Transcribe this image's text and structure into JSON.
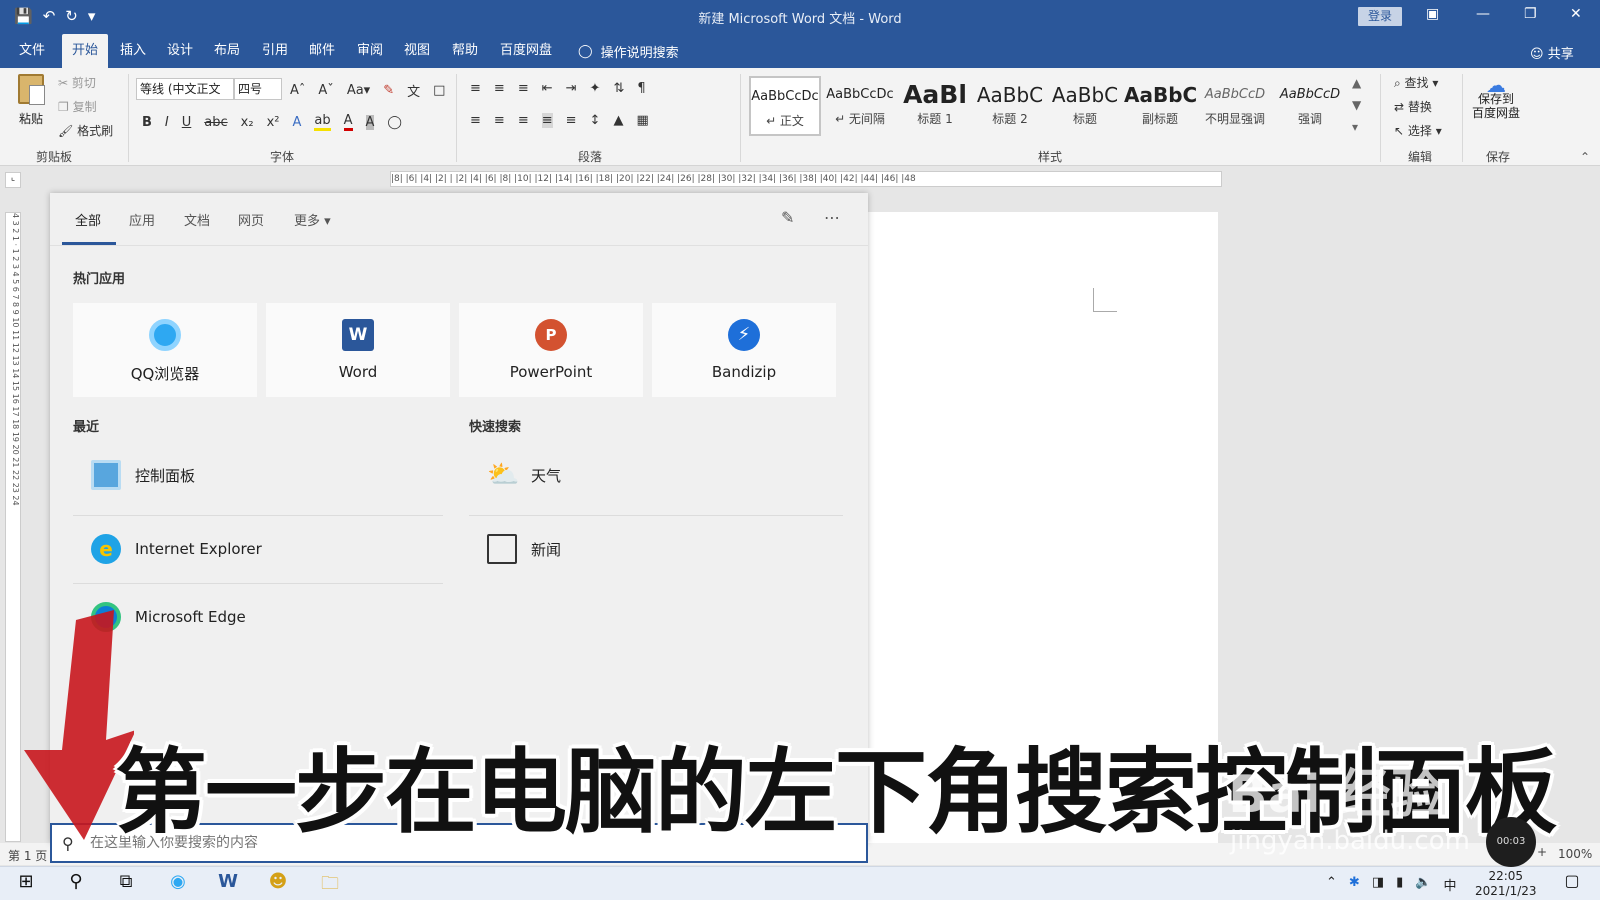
{
  "window": {
    "title": "新建 Microsoft Word 文档 - Word",
    "login_label": "登录",
    "share_label": "共享"
  },
  "qat": [
    "save-icon",
    "undo-icon",
    "redo-icon",
    "customize-icon"
  ],
  "tabs": [
    "文件",
    "开始",
    "插入",
    "设计",
    "布局",
    "引用",
    "邮件",
    "审阅",
    "视图",
    "帮助",
    "百度网盘"
  ],
  "active_tab": "开始",
  "tell_me": "操作说明搜索",
  "ribbon": {
    "clipboard": {
      "paste": "粘贴",
      "cut": "剪切",
      "copy": "复制",
      "format_painter": "格式刷",
      "label": "剪贴板"
    },
    "font": {
      "font_name": "等线 (中文正文",
      "font_size": "四号",
      "label": "字体"
    },
    "paragraph": {
      "label": "段落"
    },
    "styles": {
      "label": "样式",
      "items": [
        {
          "sample": "AaBbCcDc",
          "name": "↵ 正文"
        },
        {
          "sample": "AaBbCcDc",
          "name": "↵ 无间隔"
        },
        {
          "sample": "AaBl",
          "name": "标题 1"
        },
        {
          "sample": "AaBbC",
          "name": "标题 2"
        },
        {
          "sample": "AaBbC",
          "name": "标题"
        },
        {
          "sample": "AaBbC",
          "name": "副标题"
        },
        {
          "sample": "AaBbCcD",
          "name": "不明显强调"
        },
        {
          "sample": "AaBbCcD",
          "name": "强调"
        }
      ]
    },
    "editing": {
      "find": "查找",
      "replace": "替换",
      "select": "选择",
      "label": "编辑"
    },
    "save": {
      "button": "保存到\n百度网盘",
      "label": "保存"
    }
  },
  "ruler_marks": "|8| |6| |4| |2| | |2| |4| |6| |8| |10| |12| |14| |16| |18| |20| |22| |24| |26| |28| |30| |32| |34| |36| |38| |40| |42| |44| |46| |48",
  "vruler_marks": "4 3 2 1 · 1 2 3 4 5 6 7 8 9 10 11 12 13 14 15 16 17 18 19 20 21 22 23 24",
  "status": {
    "page": "第 1 页",
    "zoom": "100%"
  },
  "search_panel": {
    "tabs": [
      "全部",
      "应用",
      "文档",
      "网页",
      "更多"
    ],
    "hot_apps_title": "热门应用",
    "hot_apps": [
      {
        "name": "QQ浏览器",
        "icon": "qq-browser-icon"
      },
      {
        "name": "Word",
        "icon": "word-icon"
      },
      {
        "name": "PowerPoint",
        "icon": "powerpoint-icon"
      },
      {
        "name": "Bandizip",
        "icon": "bandizip-icon"
      }
    ],
    "recent_title": "最近",
    "recent": [
      {
        "name": "控制面板",
        "icon": "control-panel-icon"
      },
      {
        "name": "Internet Explorer",
        "icon": "internet-explorer-icon"
      },
      {
        "name": "Microsoft Edge",
        "icon": "edge-icon"
      }
    ],
    "quick_title": "快速搜索",
    "quick": [
      {
        "name": "天气",
        "icon": "weather-icon"
      },
      {
        "name": "新闻",
        "icon": "news-icon"
      }
    ],
    "search_placeholder": "在这里输入你要搜索的内容"
  },
  "taskbar": {
    "time": "22:05",
    "date": "2021/1/23",
    "ime": "中"
  },
  "overlay": {
    "caption": "第一步在电脑的左下角搜索控制面板",
    "watermark": "Bai 经验",
    "watermark_url": "jingyan.baidu.com",
    "recorder": "00:03"
  },
  "colors": {
    "word_blue": "#2b579a",
    "ribbon_bg": "#f3f3f3",
    "panel_bg": "#f0f0f0"
  }
}
